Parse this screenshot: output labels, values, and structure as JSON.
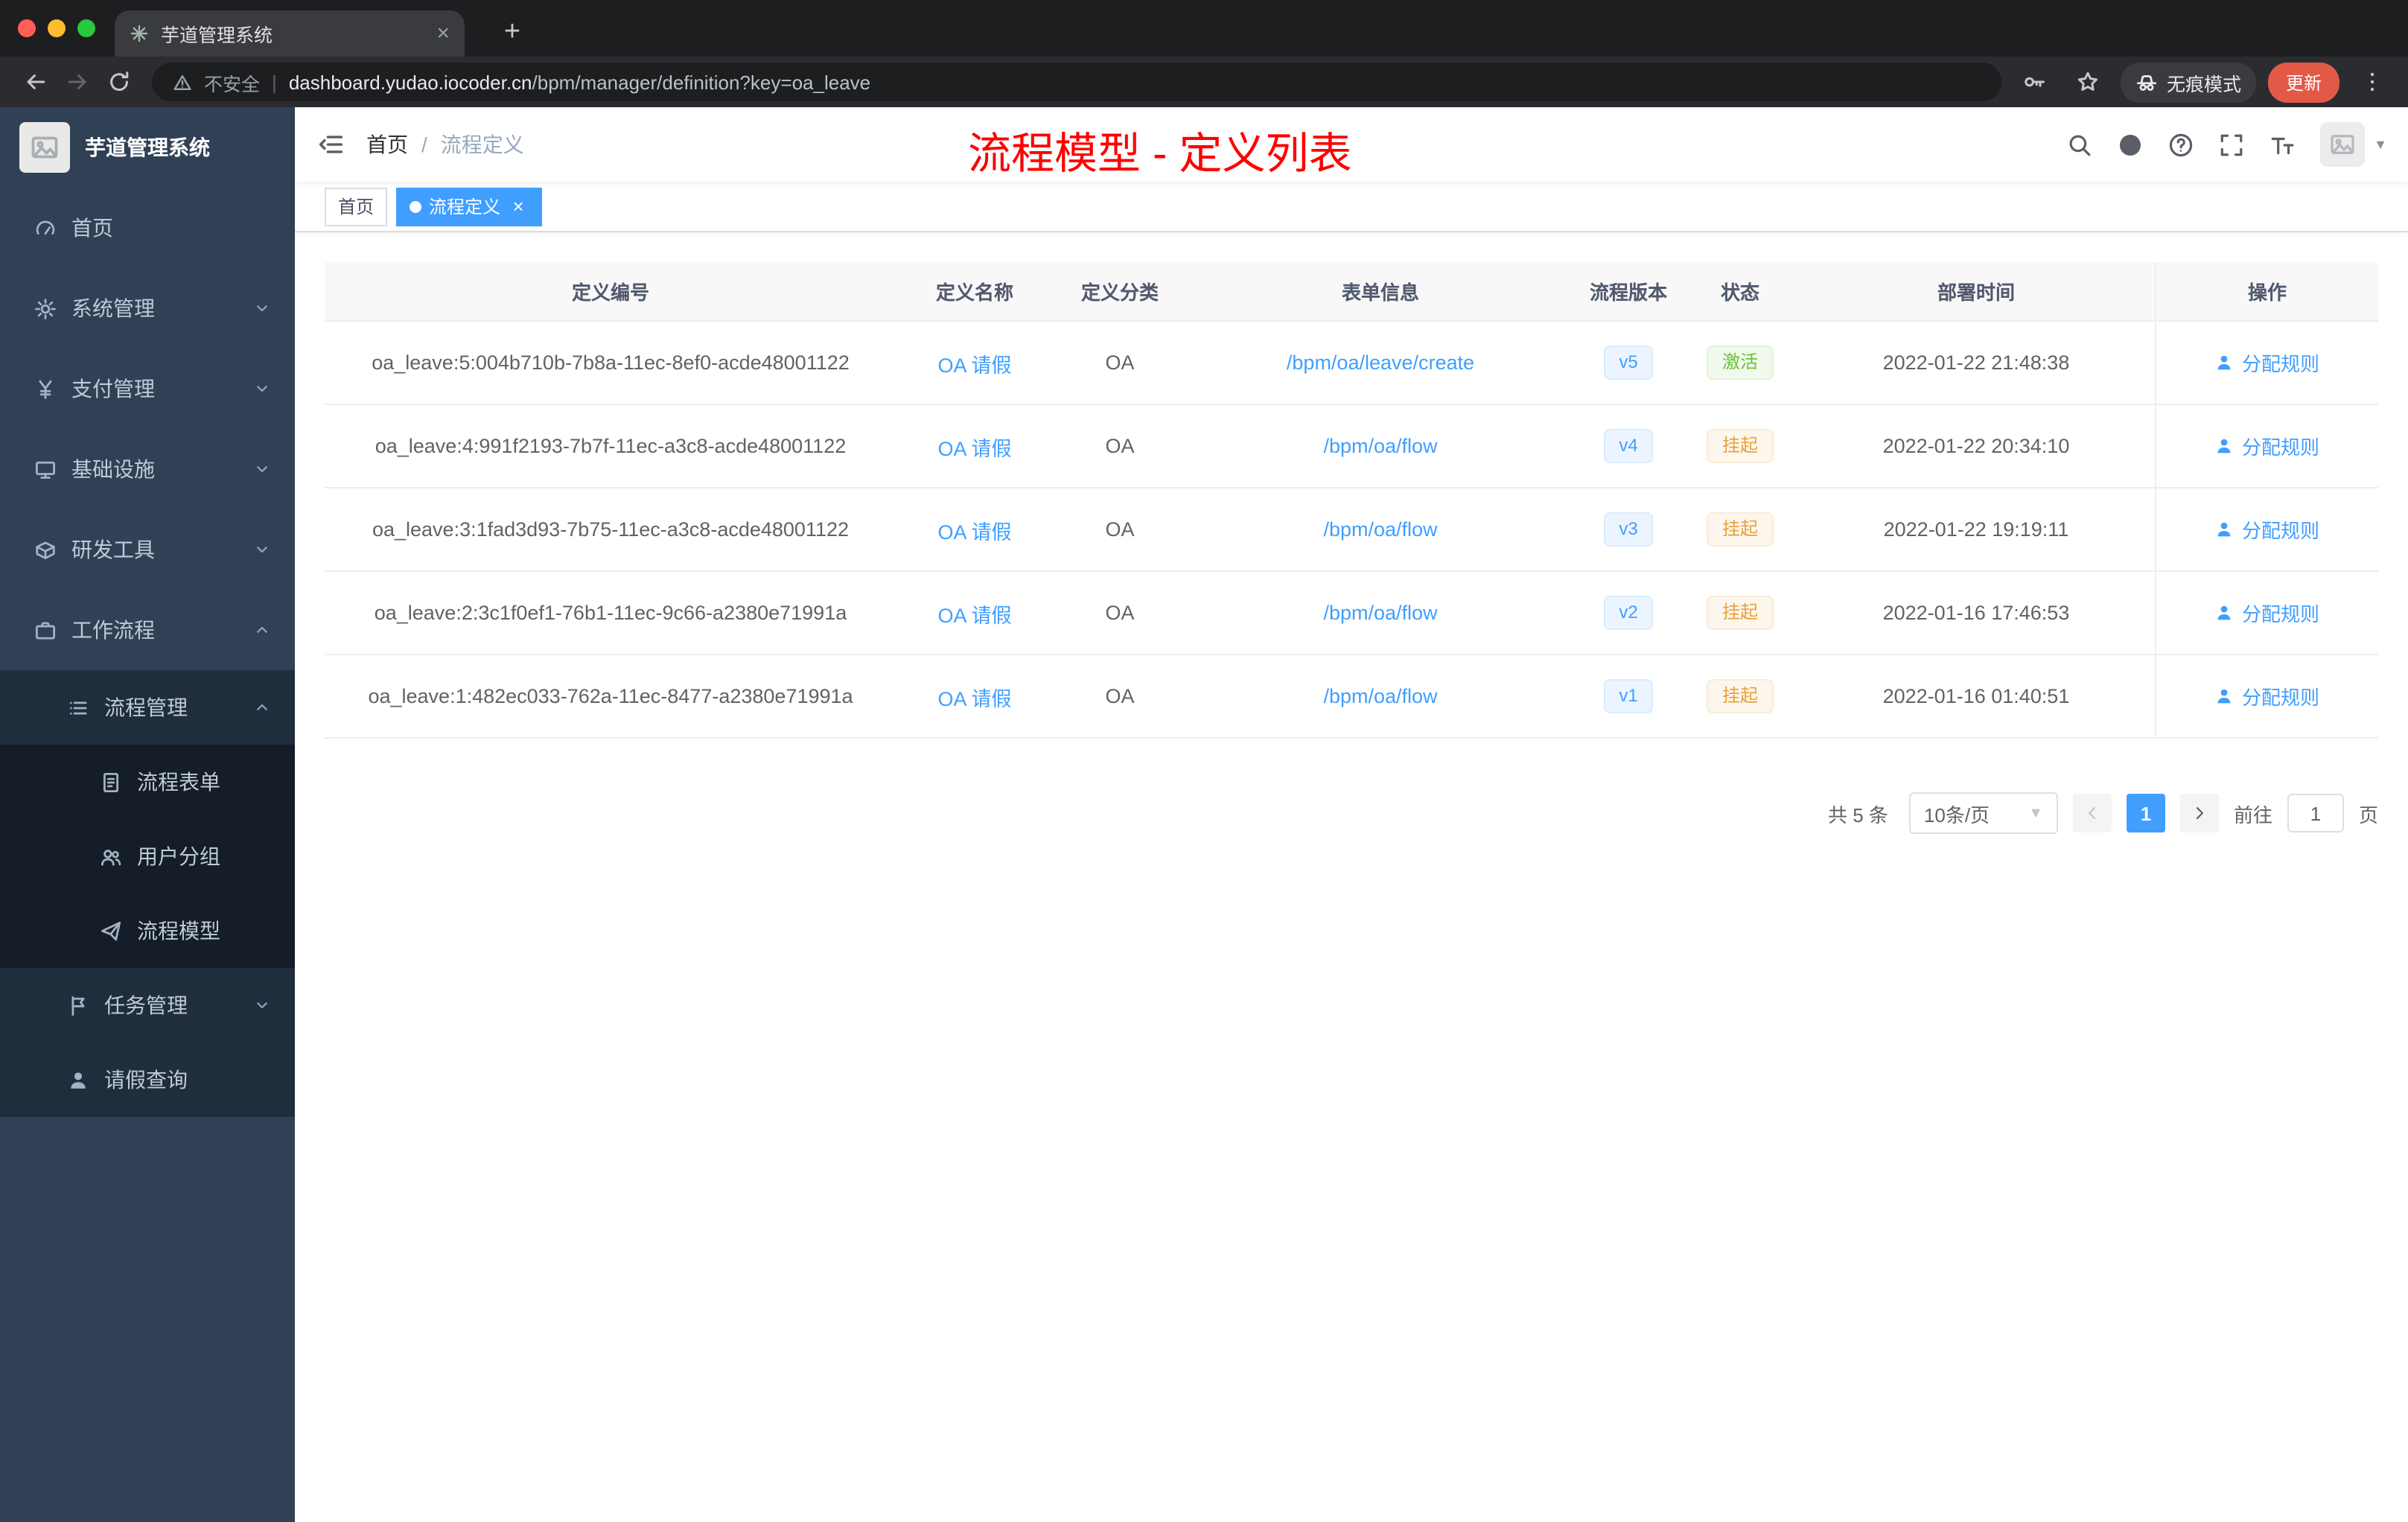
{
  "browser": {
    "tab_title": "芋道管理系统",
    "security_label": "不安全",
    "url_domain": "dashboard.yudao.iocoder.cn",
    "url_path": "/bpm/manager/definition?key=oa_leave",
    "incognito_label": "无痕模式",
    "update_label": "更新"
  },
  "sidebar": {
    "app_title": "芋道管理系统",
    "items": [
      {
        "key": "home",
        "label": "首页",
        "icon": "home-icon",
        "level": 1,
        "expandable": false,
        "expanded": false
      },
      {
        "key": "system-management",
        "label": "系统管理",
        "icon": "gear-icon",
        "level": 1,
        "expandable": true,
        "expanded": false
      },
      {
        "key": "payment-management",
        "label": "支付管理",
        "icon": "yen-icon",
        "level": 1,
        "expandable": true,
        "expanded": false
      },
      {
        "key": "infrastructure",
        "label": "基础设施",
        "icon": "monitor-icon",
        "level": 1,
        "expandable": true,
        "expanded": false
      },
      {
        "key": "dev-tools",
        "label": "研发工具",
        "icon": "box-icon",
        "level": 1,
        "expandable": true,
        "expanded": false
      },
      {
        "key": "workflow",
        "label": "工作流程",
        "icon": "briefcase-icon",
        "level": 1,
        "expandable": true,
        "expanded": true
      },
      {
        "key": "process-management",
        "label": "流程管理",
        "icon": "list-icon",
        "level": 2,
        "expandable": true,
        "expanded": true
      },
      {
        "key": "process-form",
        "label": "流程表单",
        "icon": "document-icon",
        "level": 3,
        "expandable": false,
        "expanded": false
      },
      {
        "key": "user-group",
        "label": "用户分组",
        "icon": "users-icon",
        "level": 3,
        "expandable": false,
        "expanded": false
      },
      {
        "key": "process-model",
        "label": "流程模型",
        "icon": "paper-plane-icon",
        "level": 3,
        "expandable": false,
        "expanded": false
      },
      {
        "key": "task-management",
        "label": "任务管理",
        "icon": "flag-icon",
        "level": 2,
        "expandable": true,
        "expanded": false
      },
      {
        "key": "leave-query",
        "label": "请假查询",
        "icon": "person-icon",
        "level": 2,
        "expandable": false,
        "expanded": false
      }
    ]
  },
  "header": {
    "breadcrumb_home": "首页",
    "breadcrumb_separator": "/",
    "breadcrumb_current": "流程定义",
    "annotation": "流程模型 - 定义列表"
  },
  "tags": [
    {
      "label": "首页",
      "active": false,
      "closable": false
    },
    {
      "label": "流程定义",
      "active": true,
      "closable": true
    }
  ],
  "table": {
    "columns": [
      {
        "key": "definition-id",
        "label": "定义编号"
      },
      {
        "key": "definition-name",
        "label": "定义名称"
      },
      {
        "key": "category",
        "label": "定义分类"
      },
      {
        "key": "form-info",
        "label": "表单信息"
      },
      {
        "key": "process-version",
        "label": "流程版本"
      },
      {
        "key": "status",
        "label": "状态"
      },
      {
        "key": "deploy-time",
        "label": "部署时间"
      },
      {
        "key": "actions",
        "label": "操作"
      }
    ],
    "action_label": "分配规则",
    "rows": [
      {
        "id": "oa_leave:5:004b710b-7b8a-11ec-8ef0-acde48001122",
        "name": "OA 请假",
        "category": "OA",
        "form": "/bpm/oa/leave/create",
        "version": "v5",
        "status": "激活",
        "status_type": "success",
        "deploy_time": "2022-01-22 21:48:38"
      },
      {
        "id": "oa_leave:4:991f2193-7b7f-11ec-a3c8-acde48001122",
        "name": "OA 请假",
        "category": "OA",
        "form": "/bpm/oa/flow",
        "version": "v4",
        "status": "挂起",
        "status_type": "warning",
        "deploy_time": "2022-01-22 20:34:10"
      },
      {
        "id": "oa_leave:3:1fad3d93-7b75-11ec-a3c8-acde48001122",
        "name": "OA 请假",
        "category": "OA",
        "form": "/bpm/oa/flow",
        "version": "v3",
        "status": "挂起",
        "status_type": "warning",
        "deploy_time": "2022-01-22 19:19:11"
      },
      {
        "id": "oa_leave:2:3c1f0ef1-76b1-11ec-9c66-a2380e71991a",
        "name": "OA 请假",
        "category": "OA",
        "form": "/bpm/oa/flow",
        "version": "v2",
        "status": "挂起",
        "status_type": "warning",
        "deploy_time": "2022-01-16 17:46:53"
      },
      {
        "id": "oa_leave:1:482ec033-762a-11ec-8477-a2380e71991a",
        "name": "OA 请假",
        "category": "OA",
        "form": "/bpm/oa/flow",
        "version": "v1",
        "status": "挂起",
        "status_type": "warning",
        "deploy_time": "2022-01-16 01:40:51"
      }
    ]
  },
  "pagination": {
    "total_label": "共 5 条",
    "page_size": "10条/页",
    "current_page": "1",
    "goto_label": "前往",
    "goto_value": "1",
    "goto_unit": "页"
  },
  "colors": {
    "accent": "#409eff",
    "success": "#67c23a",
    "warning": "#e6a23c",
    "annotation": "#fe0000",
    "sidebar_bg": "#304156"
  }
}
